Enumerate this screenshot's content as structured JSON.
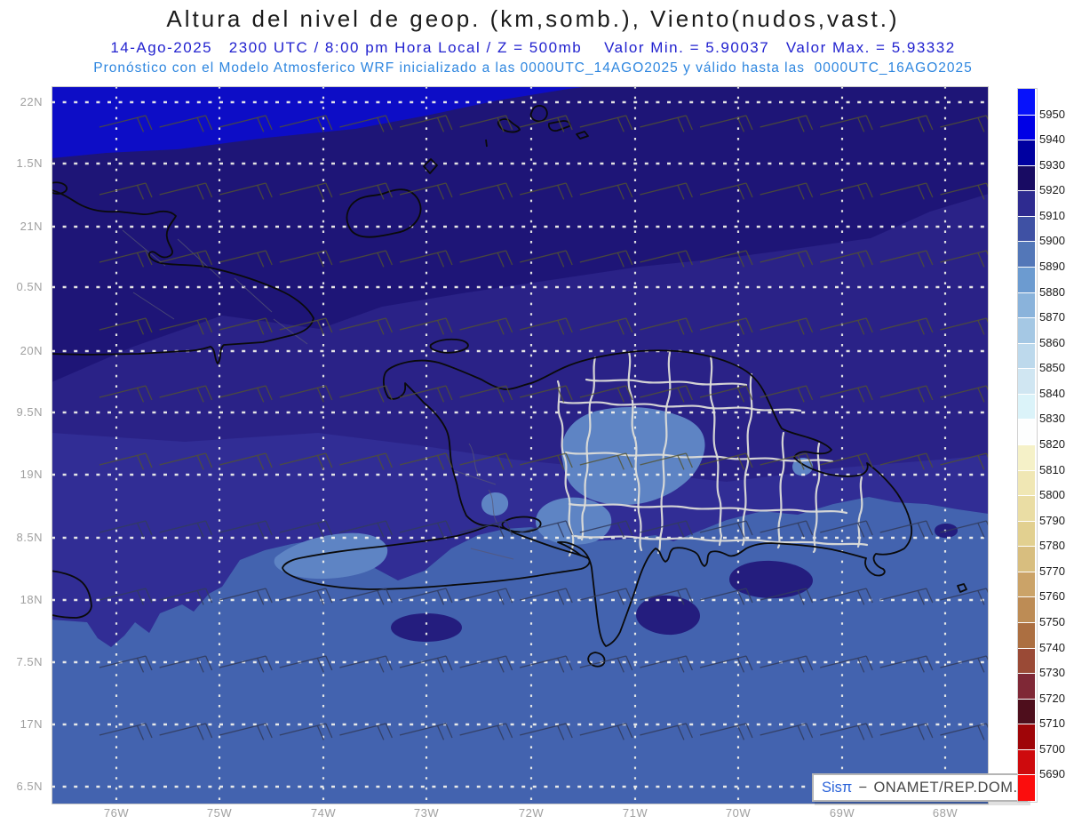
{
  "header": {
    "title": "Altura del nivel de geop. (km,somb.), Viento(nudos,vast.)",
    "subtitle_line1": "14-Ago-2025   2300 UTC / 8:00 pm Hora Local / Z = 500mb    Valor Min. = 5.90037   Valor Max. = 5.93332",
    "subtitle_line2": "Pronóstico con el Modelo Atmosferico WRF inicializado a las 0000UTC_14AGO2025 y válido hasta las  0000UTC_16AGO2025"
  },
  "axes": {
    "lat_labels": [
      "22N",
      "1.5N",
      "21N",
      "0.5N",
      "20N",
      "9.5N",
      "19N",
      "8.5N",
      "18N",
      "7.5N",
      "17N",
      "6.5N"
    ],
    "lon_labels": [
      "76W",
      "75W",
      "74W",
      "73W",
      "72W",
      "71W",
      "70W",
      "69W",
      "68W"
    ]
  },
  "colorbar": {
    "tick_labels": [
      "5950",
      "5940",
      "5930",
      "5920",
      "5910",
      "5900",
      "5890",
      "5880",
      "5870",
      "5860",
      "5850",
      "5840",
      "5830",
      "5820",
      "5810",
      "5800",
      "5790",
      "5780",
      "5770",
      "5760",
      "5750",
      "5740",
      "5730",
      "5720",
      "5710",
      "5700",
      "5690"
    ],
    "segment_colors": [
      "#0712fb",
      "#0000e6",
      "#0000a0",
      "#180b63",
      "#2e2b90",
      "#3f51a4",
      "#5377b8",
      "#6c9bd0",
      "#8ab3db",
      "#a5c8e4",
      "#bdd9ec",
      "#d0e6f2",
      "#dbf3f9",
      "#fdfefe",
      "#f5f1c8",
      "#f0e7b4",
      "#eadda4",
      "#e2d090",
      "#d8be7f",
      "#cba368",
      "#bd8c55",
      "#ac6f41",
      "#9a4a36",
      "#7f2836",
      "#4e0e1c",
      "#9f0508",
      "#ce0a0d",
      "#fb0d0d"
    ]
  },
  "map_colors": {
    "band_5930_5940": "#0d0dc6",
    "band_5920_5930": "#1e1577",
    "band_5915_5920": "#2a2287",
    "band_5910_5915": "#312d95",
    "band_5900_5910": "#4363af",
    "patch_5890_5900": "#5e84c4",
    "dark_pocket": "#241d7e",
    "grid_dots": "#f5f5ee",
    "coastline": "#0a0a0a",
    "province_border": "#dcdcd8",
    "faint_border": "#565676",
    "barb_north": "rgba(84,84,46,0.8)",
    "barb_south": "rgba(50,60,95,0.88)"
  },
  "credit": {
    "brand": "Sisπ",
    "separator": "−",
    "org": "ONAMET/REP.DOM."
  },
  "chart_data": {
    "type": "heatmap",
    "title": "Altura del nivel de geop. (km,somb.), Viento(nudos,vast.)",
    "variable": "Altura geopotencial a 500mb (km, sombreado) y viento (nudos, barbas)",
    "model": "WRF",
    "initialized": "0000UTC_14AGO2025",
    "valid_until": "0000UTC_16AGO2025",
    "valid_time": "14-Ago-2025 2300 UTC / 8:00 pm Hora Local",
    "level": "500mb",
    "value_min_km": 5.90037,
    "value_max_km": 5.93332,
    "colorbar_ticks_m": [
      5950,
      5940,
      5930,
      5920,
      5910,
      5900,
      5890,
      5880,
      5870,
      5860,
      5850,
      5840,
      5830,
      5820,
      5810,
      5800,
      5790,
      5780,
      5770,
      5760,
      5750,
      5740,
      5730,
      5720,
      5710,
      5700,
      5690
    ],
    "lat_ticks_deg_n": [
      22,
      21.5,
      21,
      20.5,
      20,
      19.5,
      19,
      18.5,
      18,
      17.5,
      17,
      16.5
    ],
    "lon_ticks_deg_w": [
      76,
      75,
      74,
      73,
      72,
      71,
      70,
      69,
      68
    ],
    "grid": true,
    "legend_position": "right-colorbar",
    "field_summary": [
      {
        "region": "franja norte (~22N, oeste)",
        "geopotencial_m": "5930-5940"
      },
      {
        "region": "norte (20.5N-22N, Cuba/Bahamas)",
        "geopotencial_m": "5920-5930"
      },
      {
        "region": "centro (18.5N-20.5N, La Española)",
        "geopotencial_m": "5910-5920"
      },
      {
        "region": "mar Caribe sur (16.5N-18.5N)",
        "geopotencial_m": "5900-5910"
      },
      {
        "region": "parches centro de la República Dominicana",
        "geopotencial_m": "5890-5900"
      }
    ],
    "wind_summary": "Barbas de viento del E-ENE, aprox. 10-20 nudos en todo el dominio"
  }
}
